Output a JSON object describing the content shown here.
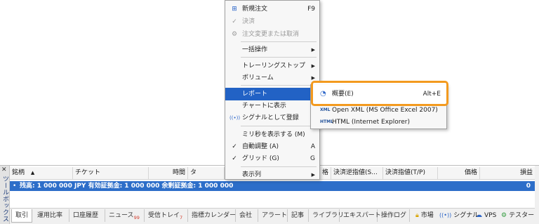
{
  "menu": {
    "items": [
      {
        "label": "新規注文",
        "shortcut": "F9",
        "icon": "new-order-icon"
      },
      {
        "label": "決済",
        "icon": "check-icon"
      },
      {
        "label": "注文変更または取消",
        "icon": "gear-icon"
      },
      {
        "label": "一括操作"
      },
      {
        "label": "トレーリングストップ"
      },
      {
        "label": "ボリューム"
      },
      {
        "label": "レポート"
      },
      {
        "label": "チャートに表示"
      },
      {
        "label": "シグナルとして登録",
        "icon": "signal-icon"
      },
      {
        "label": "ミリ秒を表示する (M)"
      },
      {
        "label": "自動調整 (A)",
        "shortcut": "A"
      },
      {
        "label": "グリッド (G)",
        "shortcut": "G"
      },
      {
        "label": "表示列"
      }
    ]
  },
  "submenu": {
    "items": [
      {
        "label": "概要(E)",
        "shortcut": "Alt+E",
        "icon": "report-icon"
      },
      {
        "label": "Open XML (MS Office Excel 2007)",
        "icon": "xml-icon"
      },
      {
        "label": "HTML (Internet Explorer)",
        "icon": "html-icon"
      }
    ],
    "icon_texts": {
      "xml": "XML",
      "html": "HTML"
    }
  },
  "toolbox": {
    "title": "ツールボックス",
    "columns": [
      "銘柄",
      "チケット",
      "時間",
      "タ",
      "格",
      "決済逆指値(S...",
      "決済指値(T/P)",
      "価格",
      "損益"
    ],
    "balance_text": "残高: 1 000 000 JPY  有効証拠金: 1 000 000  余剰証拠金: 1 000 000",
    "balance_value": "0",
    "tabs": [
      {
        "label": "取引"
      },
      {
        "label": "運用比率"
      },
      {
        "label": "口座履歴"
      },
      {
        "label": "ニュース",
        "badge": "99"
      },
      {
        "label": "受信トレイ",
        "badge": "7"
      },
      {
        "label": "指標カレンダー"
      },
      {
        "label": "会社"
      },
      {
        "label": "アラート"
      },
      {
        "label": "記事"
      },
      {
        "label": "ライブラリ"
      },
      {
        "label": "エキスパート"
      },
      {
        "label": "操作ログ"
      }
    ],
    "status": [
      {
        "label": "市場",
        "icon": "lock-icon"
      },
      {
        "label": "シグナル",
        "icon": "signal-icon"
      },
      {
        "label": "VPS",
        "icon": "cloud-icon"
      },
      {
        "label": "テスター",
        "icon": "gear-icon"
      }
    ]
  },
  "colors": {
    "highlight": "#f39a1f",
    "selection": "#2262c5",
    "balance_row": "#2d6ec9"
  }
}
